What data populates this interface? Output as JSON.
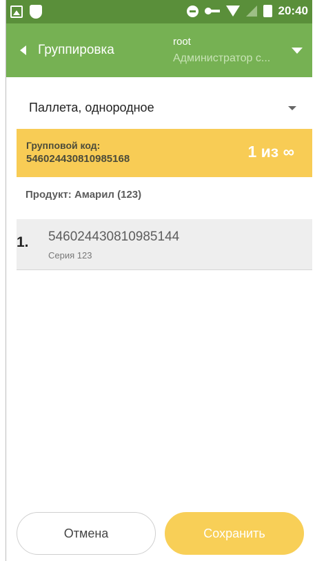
{
  "status_bar": {
    "time": "20:40",
    "left_icons": [
      "image-icon",
      "shield-icon"
    ],
    "right_icons": [
      "do-not-disturb-icon",
      "key-icon",
      "wifi-off-icon",
      "signal-icon",
      "battery-icon"
    ]
  },
  "app_bar": {
    "title": "Группировка",
    "user_name": "root",
    "user_role": "Администратор с..."
  },
  "type_select": {
    "value": "Паллета, однородное"
  },
  "group_code": {
    "label": "Групповой код:",
    "code": "546024430810985168",
    "count": "1 из ∞"
  },
  "product": {
    "text": "Продукт: Амарил (123)"
  },
  "items": [
    {
      "index": "1.",
      "code": "546024430810985144",
      "series": "Серия 123"
    }
  ],
  "buttons": {
    "cancel": "Отмена",
    "save": "Сохранить"
  },
  "colors": {
    "status_bar": "#5a8f3a",
    "app_bar": "#76b153",
    "banner": "#f8cc55",
    "save_button": "#f8cf57"
  }
}
